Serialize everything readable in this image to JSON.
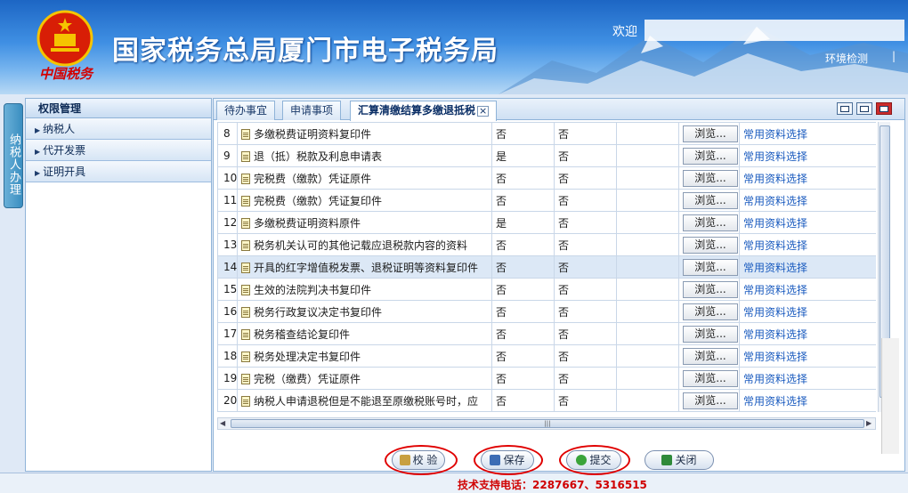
{
  "header": {
    "site_title": "国家税务总局厦门市电子税务局",
    "brand_text": "中国税务",
    "welcome": "欢迎",
    "env_check": "环境检测",
    "separator": "|"
  },
  "left_tab": {
    "label": "纳税人办理"
  },
  "menu": {
    "title": "权限管理",
    "items": [
      {
        "label": "纳税人"
      },
      {
        "label": "代开发票"
      },
      {
        "label": "证明开具"
      }
    ]
  },
  "tabs": [
    {
      "label": "待办事宜"
    },
    {
      "label": "申请事项"
    },
    {
      "label": "汇算清缴结算多缴退抵税",
      "close": "×"
    }
  ],
  "table": {
    "browse_label": "浏览...",
    "link_label": "常用资料选择",
    "rows": [
      {
        "num": "8",
        "name": "多缴税费证明资料复印件",
        "c1": "否",
        "c2": "否"
      },
      {
        "num": "9",
        "name": "退（抵）税款及利息申请表",
        "c1": "是",
        "c2": "否"
      },
      {
        "num": "10",
        "name": "完税费（缴款）凭证原件",
        "c1": "否",
        "c2": "否"
      },
      {
        "num": "11",
        "name": "完税费（缴款）凭证复印件",
        "c1": "否",
        "c2": "否"
      },
      {
        "num": "12",
        "name": "多缴税费证明资料原件",
        "c1": "是",
        "c2": "否"
      },
      {
        "num": "13",
        "name": "税务机关认可的其他记载应退税款内容的资料",
        "c1": "否",
        "c2": "否"
      },
      {
        "num": "14",
        "name": "开具的红字增值税发票、退税证明等资料复印件",
        "c1": "否",
        "c2": "否"
      },
      {
        "num": "15",
        "name": "生效的法院判决书复印件",
        "c1": "否",
        "c2": "否"
      },
      {
        "num": "16",
        "name": "税务行政复议决定书复印件",
        "c1": "否",
        "c2": "否"
      },
      {
        "num": "17",
        "name": "税务稽查结论复印件",
        "c1": "否",
        "c2": "否"
      },
      {
        "num": "18",
        "name": "税务处理决定书复印件",
        "c1": "否",
        "c2": "否"
      },
      {
        "num": "19",
        "name": "完税（缴费）凭证原件",
        "c1": "否",
        "c2": "否"
      },
      {
        "num": "20",
        "name": "纳税人申请退税但是不能退至原缴税账号时，应",
        "c1": "否",
        "c2": "否"
      }
    ]
  },
  "buttons": {
    "verify": "校 验",
    "save": "保存",
    "submit": "提交",
    "close": "关闭"
  },
  "support": "技术支持电话：2287667、5316515",
  "colors": {
    "accent": "#1d66c4",
    "link": "#1a5bbf",
    "highlight": "#e00000"
  }
}
